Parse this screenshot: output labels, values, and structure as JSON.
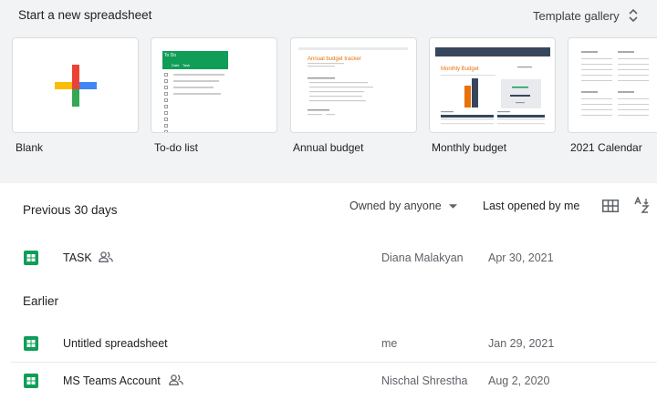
{
  "templates": {
    "heading": "Start a new spreadsheet",
    "gallery_label": "Template gallery",
    "tiles": [
      {
        "label": "Blank"
      },
      {
        "label": "To-do list",
        "preview_title": "To Do",
        "col_headers": [
          "Date",
          "Task"
        ]
      },
      {
        "label": "Annual budget",
        "preview_title": "Annual budget tracker"
      },
      {
        "label": "Monthly budget",
        "preview_title": "Monthly Budget"
      },
      {
        "label": "2021 Calendar"
      }
    ]
  },
  "files": {
    "recent_heading": "Previous 30 days",
    "earlier_heading": "Earlier",
    "owner_filter": "Owned by anyone",
    "sort_label": "Last opened by me",
    "rows": [
      {
        "name": "TASK",
        "owner": "Diana Malakyan",
        "date": "Apr 30, 2021",
        "shared": true
      },
      {
        "name": "Untitled spreadsheet",
        "owner": "me",
        "date": "Jan 29, 2021",
        "shared": false
      },
      {
        "name": "MS Teams Account",
        "owner": "Nischal Shrestha",
        "date": "Aug 2, 2020",
        "shared": true
      }
    ]
  },
  "icons": {
    "plus": "plus-icon",
    "unfold": "unfold-icon",
    "dropdown": "dropdown-arrow-icon",
    "grid": "grid-view-icon",
    "sort": "sort-az-icon",
    "sheets": "sheets-file-icon",
    "shared": "shared-people-icon"
  },
  "colors": {
    "sheets_green": "#0f9d58",
    "plus_blue": "#4285f4",
    "plus_red": "#ea4335",
    "plus_yellow": "#fbbc04",
    "plus_green": "#34a853",
    "strip_bg": "#f1f3f4"
  }
}
